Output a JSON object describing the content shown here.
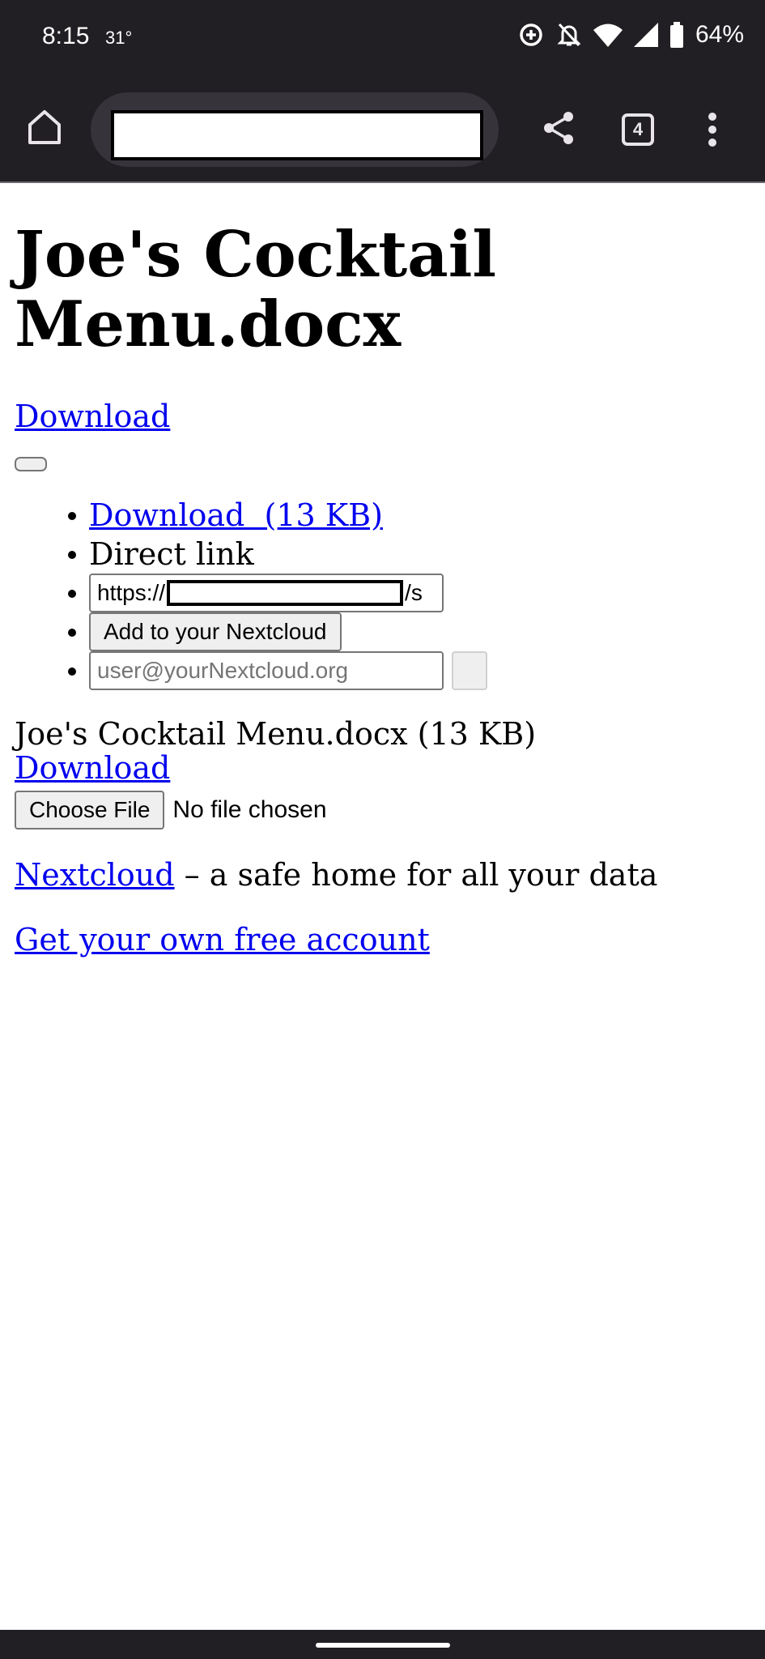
{
  "status_bar": {
    "time": "8:15",
    "temperature": "31°",
    "battery": "64%"
  },
  "browser_toolbar": {
    "tab_count": "4"
  },
  "page": {
    "title": "Joe's Cocktail Menu.docx",
    "download_link": "Download",
    "menu": {
      "download_label": "Download  (13 KB)",
      "direct_link_label": "Direct link",
      "direct_link_prefix": "https://",
      "direct_link_suffix": "/s",
      "add_button": "Add to your Nextcloud",
      "remote_placeholder": "user@yourNextcloud.org"
    },
    "file_info": "Joe's Cocktail Menu.docx (13 KB)",
    "download_link_2": "Download",
    "choose_file_button": "Choose File",
    "no_file_text": "No file chosen",
    "footer": {
      "brand_link": "Nextcloud",
      "tagline": " – a safe home for all your data",
      "account_link": "Get your own free account"
    }
  }
}
